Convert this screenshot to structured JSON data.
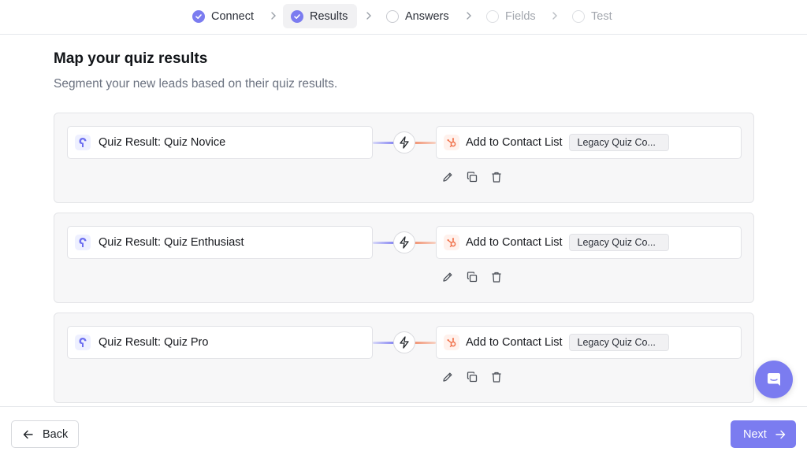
{
  "stepper": {
    "steps": [
      {
        "label": "Connect",
        "state": "done"
      },
      {
        "label": "Results",
        "state": "done-active"
      },
      {
        "label": "Answers",
        "state": "todo"
      },
      {
        "label": "Fields",
        "state": "disabled"
      },
      {
        "label": "Test",
        "state": "disabled"
      }
    ]
  },
  "header": {
    "title": "Map your quiz results",
    "subtitle": "Segment your new leads based on their quiz results."
  },
  "mappings": [
    {
      "source": "Quiz Result: Quiz Novice",
      "action": "Add to Contact List",
      "tag": "Legacy Quiz Co..."
    },
    {
      "source": "Quiz Result: Quiz Enthusiast",
      "action": "Add to Contact List",
      "tag": "Legacy Quiz Co..."
    },
    {
      "source": "Quiz Result: Quiz Pro",
      "action": "Add to Contact List",
      "tag": "Legacy Quiz Co..."
    }
  ],
  "icons": {
    "source": "quiz-app-icon",
    "connector": "lightning-bolt-icon",
    "destination": "hubspot-icon",
    "edit": "pencil-icon",
    "duplicate": "copy-icon",
    "delete": "trash-icon",
    "chat": "chat-bubble-icon"
  },
  "footer": {
    "back_label": "Back",
    "next_label": "Next"
  },
  "colors": {
    "accent": "#7b7cf0",
    "hubspot": "#f0714a",
    "card_bg": "#f7f7f8"
  }
}
